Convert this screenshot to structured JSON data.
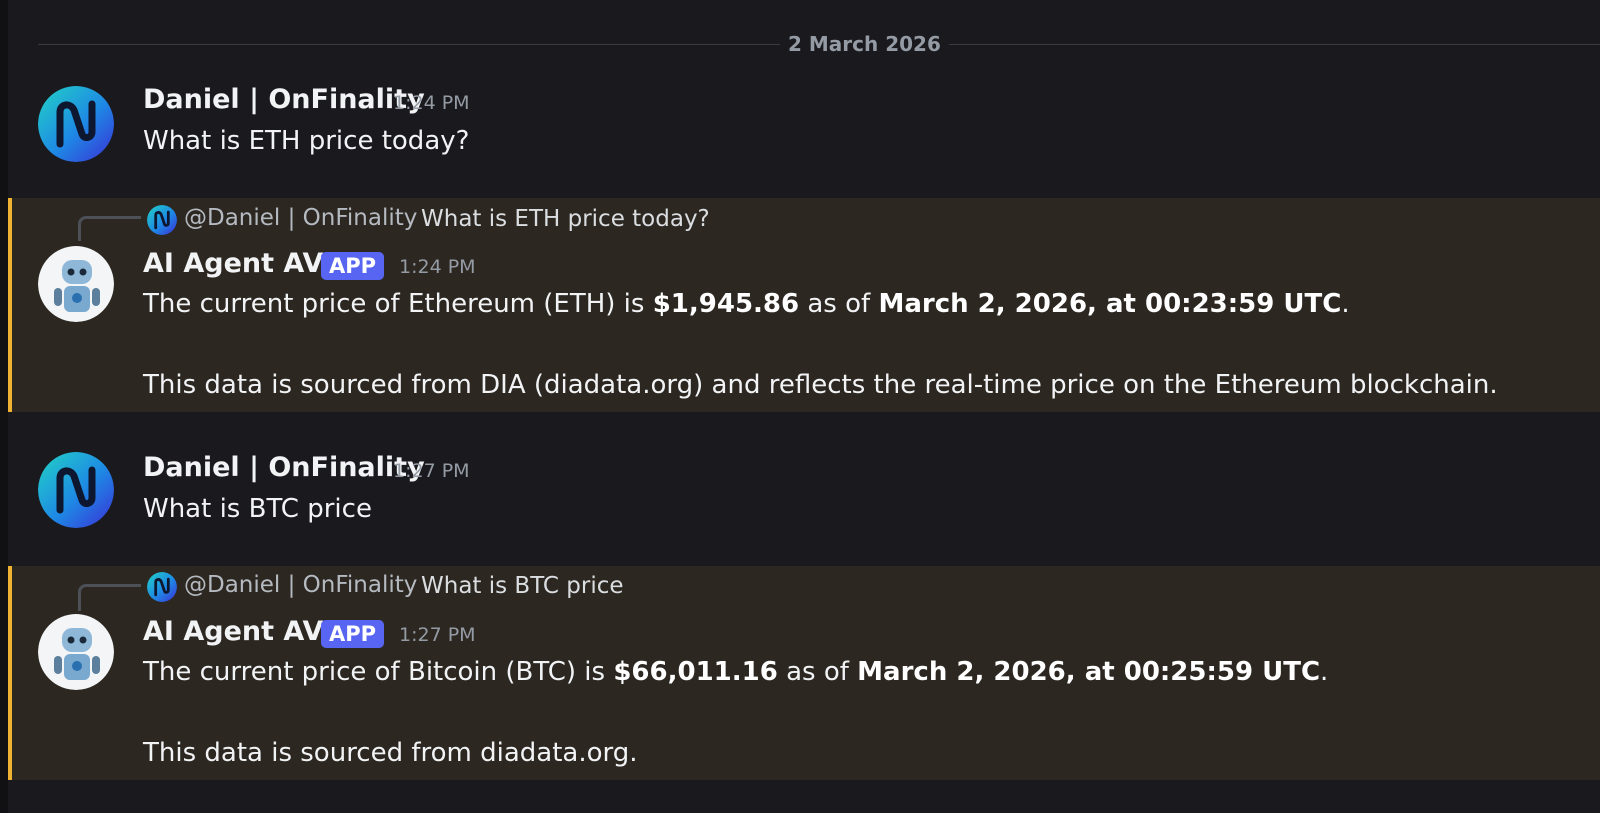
{
  "date_divider": "2 March 2026",
  "messages": [
    {
      "author": "Daniel | OnFinality",
      "time": "1:24 PM",
      "text": "What is ETH price today?"
    },
    {
      "reply_to": {
        "name": "@Daniel | OnFinality",
        "text": "What is ETH price today?"
      },
      "author": "AI Agent AVA",
      "badge": "APP",
      "time": "1:24 PM",
      "line1": {
        "pre": "The current price of Ethereum (ETH) is ",
        "price": "$1,945.86",
        "mid": " as of ",
        "date": "March 2, 2026, at 00:23:59 UTC",
        "post": "."
      },
      "line2": "This data is sourced from DIA (diadata.org) and reflects the real-time price on the Ethereum blockchain."
    },
    {
      "author": "Daniel | OnFinality",
      "time": "1:27 PM",
      "text": "What is BTC price"
    },
    {
      "reply_to": {
        "name": "@Daniel | OnFinality",
        "text": "What is BTC price"
      },
      "author": "AI Agent AVA",
      "badge": "APP",
      "time": "1:27 PM",
      "line1": {
        "pre": "The current price of Bitcoin (BTC) is ",
        "price": "$66,011.16",
        "mid": " as of ",
        "date": "March 2, 2026, at 00:25:59 UTC",
        "post": "."
      },
      "line2": "This data is sourced from diadata.org."
    }
  ],
  "icons": {
    "user_avatar": "onfinality-logo-icon",
    "bot_avatar": "robot-avatar-icon"
  },
  "colors": {
    "background": "#1a1a1e",
    "highlight_bg": "#2c2721",
    "highlight_border": "#f0b232",
    "badge": "#5865f2"
  }
}
